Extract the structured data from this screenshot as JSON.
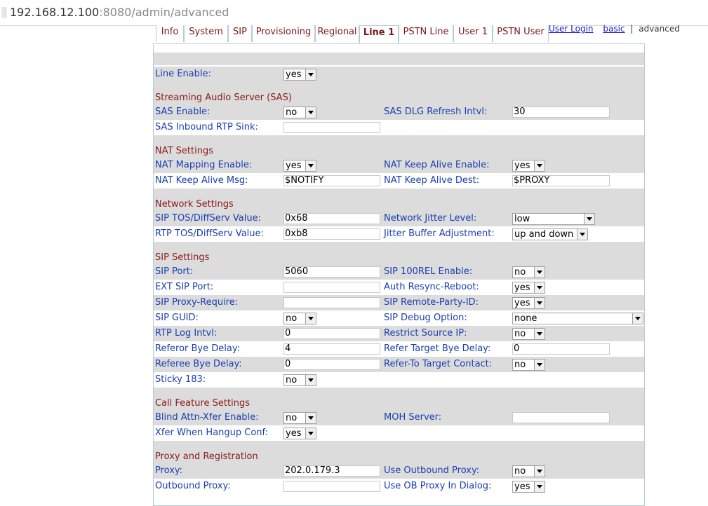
{
  "browser": {
    "url_host": "192.168.12.100",
    "url_rest": ":8080/admin/advanced"
  },
  "tabs": [
    {
      "label": "Info"
    },
    {
      "label": "System"
    },
    {
      "label": "SIP"
    },
    {
      "label": "Provisioning"
    },
    {
      "label": "Regional"
    },
    {
      "label": "Line 1"
    },
    {
      "label": "PSTN Line"
    },
    {
      "label": "User 1"
    },
    {
      "label": "PSTN User"
    }
  ],
  "links": {
    "user_login": "User Login",
    "basic": "basic",
    "separator": "|",
    "advanced": "advanced"
  },
  "line_enable": {
    "label": "Line Enable:",
    "value": "yes"
  },
  "sas": {
    "title": "Streaming Audio Server (SAS)",
    "enable": {
      "label": "SAS Enable:",
      "value": "no"
    },
    "dlg_refresh": {
      "label": "SAS DLG Refresh Intvl:",
      "value": "30"
    },
    "inbound_sink": {
      "label": "SAS Inbound RTP Sink:",
      "value": ""
    }
  },
  "nat": {
    "title": "NAT Settings",
    "mapping_enable": {
      "label": "NAT Mapping Enable:",
      "value": "yes"
    },
    "keep_alive_enable": {
      "label": "NAT Keep Alive Enable:",
      "value": "yes"
    },
    "keep_alive_msg": {
      "label": "NAT Keep Alive Msg:",
      "value": "$NOTIFY"
    },
    "keep_alive_dest": {
      "label": "NAT Keep Alive Dest:",
      "value": "$PROXY"
    }
  },
  "network": {
    "title": "Network Settings",
    "sip_tos": {
      "label": "SIP TOS/DiffServ Value:",
      "value": "0x68"
    },
    "jitter_level": {
      "label": "Network Jitter Level:",
      "value": "low"
    },
    "rtp_tos": {
      "label": "RTP TOS/DiffServ Value:",
      "value": "0xb8"
    },
    "jitter_adj": {
      "label": "Jitter Buffer Adjustment:",
      "value": "up and down"
    }
  },
  "sip": {
    "title": "SIP Settings",
    "port": {
      "label": "SIP Port:",
      "value": "5060"
    },
    "rel100": {
      "label": "SIP 100REL Enable:",
      "value": "no"
    },
    "ext_port": {
      "label": "EXT SIP Port:",
      "value": ""
    },
    "auth_resync": {
      "label": "Auth Resync-Reboot:",
      "value": "yes"
    },
    "proxy_require": {
      "label": "SIP Proxy-Require:",
      "value": ""
    },
    "remote_party": {
      "label": "SIP Remote-Party-ID:",
      "value": "yes"
    },
    "guid": {
      "label": "SIP GUID:",
      "value": "no"
    },
    "debug": {
      "label": "SIP Debug Option:",
      "value": "none"
    },
    "rtp_log": {
      "label": "RTP Log Intvl:",
      "value": "0"
    },
    "restrict_ip": {
      "label": "Restrict Source IP:",
      "value": "no"
    },
    "referor_bye": {
      "label": "Referor Bye Delay:",
      "value": "4"
    },
    "refer_target_bye": {
      "label": "Refer Target Bye Delay:",
      "value": "0"
    },
    "referee_bye": {
      "label": "Referee Bye Delay:",
      "value": "0"
    },
    "refer_to_contact": {
      "label": "Refer-To Target Contact:",
      "value": "no"
    },
    "sticky": {
      "label": "Sticky 183:",
      "value": "no"
    }
  },
  "call": {
    "title": "Call Feature Settings",
    "blind_attn": {
      "label": "Blind Attn-Xfer Enable:",
      "value": "no"
    },
    "moh_server": {
      "label": "MOH Server:",
      "value": ""
    },
    "xfer_hangup": {
      "label": "Xfer When Hangup Conf:",
      "value": "yes"
    }
  },
  "proxy": {
    "title": "Proxy and Registration",
    "proxy": {
      "label": "Proxy:",
      "value": "202.0.179.3"
    },
    "use_outbound": {
      "label": "Use Outbound Proxy:",
      "value": "no"
    },
    "outbound": {
      "label": "Outbound Proxy:",
      "value": ""
    },
    "use_ob_dialog": {
      "label": "Use OB Proxy In Dialog:",
      "value": "yes"
    }
  }
}
